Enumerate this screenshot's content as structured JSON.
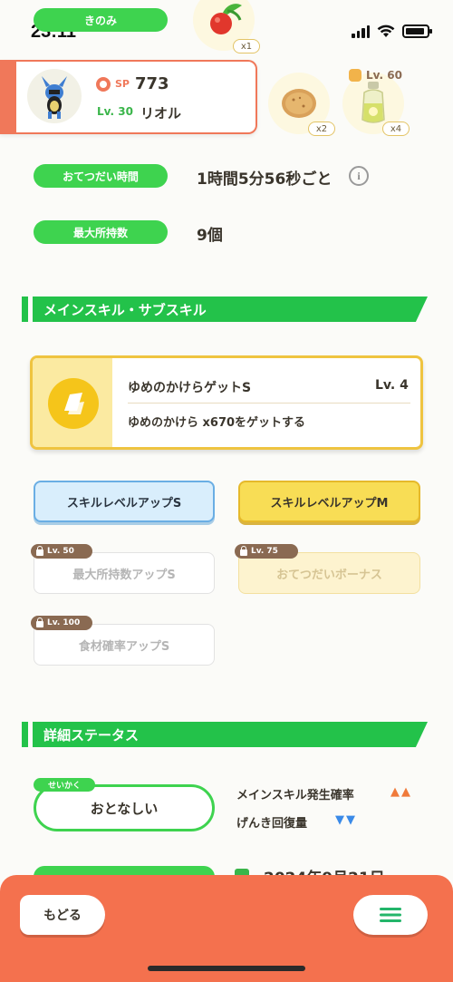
{
  "status_bar": {
    "time": "23:11"
  },
  "top_items": {
    "label_kinomi": "きのみ",
    "berry_count": "x1",
    "item2_count": "x2",
    "item3_count": "x4",
    "item3_lock_level": "Lv. 60"
  },
  "pokemon": {
    "sp_label": "SP",
    "sp_value": "773",
    "level": "Lv. 30",
    "name": "リオル"
  },
  "info": {
    "help_time_label": "おてつだい時間",
    "help_time_value": "1時間5分56秒ごと",
    "max_carry_label": "最大所持数",
    "max_carry_value": "9個"
  },
  "skills_section": {
    "title": "メインスキル・サブスキル",
    "main_skill_name": "ゆめのかけらゲットS",
    "main_skill_level": "Lv. 4",
    "main_skill_desc": "ゆめのかけら x670をゲットする"
  },
  "subskills": [
    {
      "label": "スキルレベルアップS",
      "lock": ""
    },
    {
      "label": "スキルレベルアップM",
      "lock": ""
    },
    {
      "label": "最大所持数アップS",
      "lock": "Lv. 50"
    },
    {
      "label": "おてつだいボーナス",
      "lock": "Lv. 75"
    },
    {
      "label": "食材確率アップS",
      "lock": "Lv. 100"
    }
  ],
  "details_section": {
    "title": "詳細ステータス",
    "nature_tag": "せいかく",
    "nature_value": "おとなしい",
    "up_stat": "メインスキル発生確率",
    "down_stat": "げんき回復量",
    "up_marks": "▲▲",
    "down_marks": "▼▼",
    "date_partial": "2024年9月21日"
  },
  "bottom": {
    "back_label": "もどる",
    "menu_icon": "hamburger-menu-icon"
  },
  "colors": {
    "green": "#3ed34f",
    "section_green": "#23c24a",
    "coral": "#f4714e",
    "gold": "#efc440",
    "blue_btn": "#d6ecfb",
    "yellow_btn": "#f8dd55"
  }
}
